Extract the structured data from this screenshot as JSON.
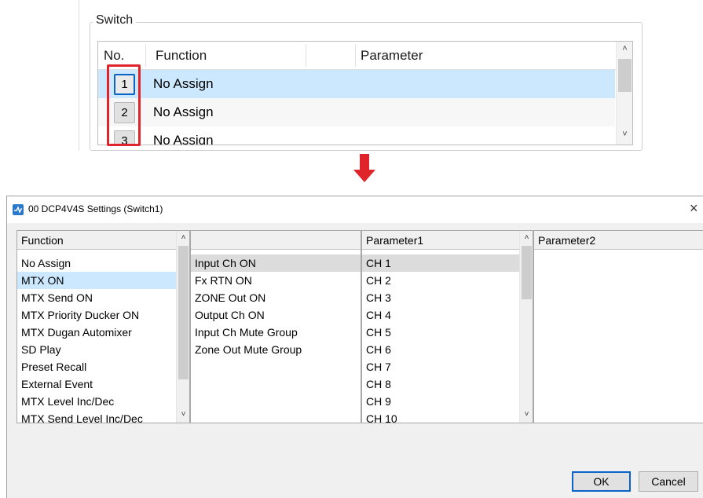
{
  "switch_group": {
    "title": "Switch",
    "columns": {
      "no": "No.",
      "function": "Function",
      "parameter": "Parameter"
    },
    "rows": [
      {
        "no": "1",
        "function": "No Assign"
      },
      {
        "no": "2",
        "function": "No Assign"
      },
      {
        "no": "3",
        "function": "No Assign"
      }
    ]
  },
  "colors": {
    "highlight_box": "#e0242c",
    "arrow": "#e0242c",
    "selection": "#cce8ff",
    "focus": "#0a64c8"
  },
  "dialog": {
    "title": "00 DCP4V4S Settings (Switch1)",
    "close_glyph": "×",
    "function_list": {
      "header": "Function",
      "items": [
        "No Assign",
        "MTX ON",
        "MTX Send ON",
        "MTX Priority Ducker ON",
        "MTX Dugan Automixer",
        "SD Play",
        "Preset Recall",
        "External Event",
        "MTX Level Inc/Dec",
        "MTX Send Level Inc/Dec"
      ],
      "selected": "MTX ON"
    },
    "sub_list": {
      "header": "",
      "items": [
        "Input Ch ON",
        "Fx RTN ON",
        "ZONE Out ON",
        "Output Ch ON",
        "Input Ch Mute Group",
        "Zone Out Mute Group"
      ],
      "selected": "Input Ch ON"
    },
    "parameter1": {
      "header": "Parameter1",
      "items": [
        "CH 1",
        "CH 2",
        "CH 3",
        "CH 4",
        "CH 5",
        "CH 6",
        "CH 7",
        "CH 8",
        "CH 9",
        "CH 10"
      ],
      "selected": "CH 1"
    },
    "parameter2": {
      "header": "Parameter2",
      "items": []
    },
    "buttons": {
      "ok": "OK",
      "cancel": "Cancel"
    }
  }
}
